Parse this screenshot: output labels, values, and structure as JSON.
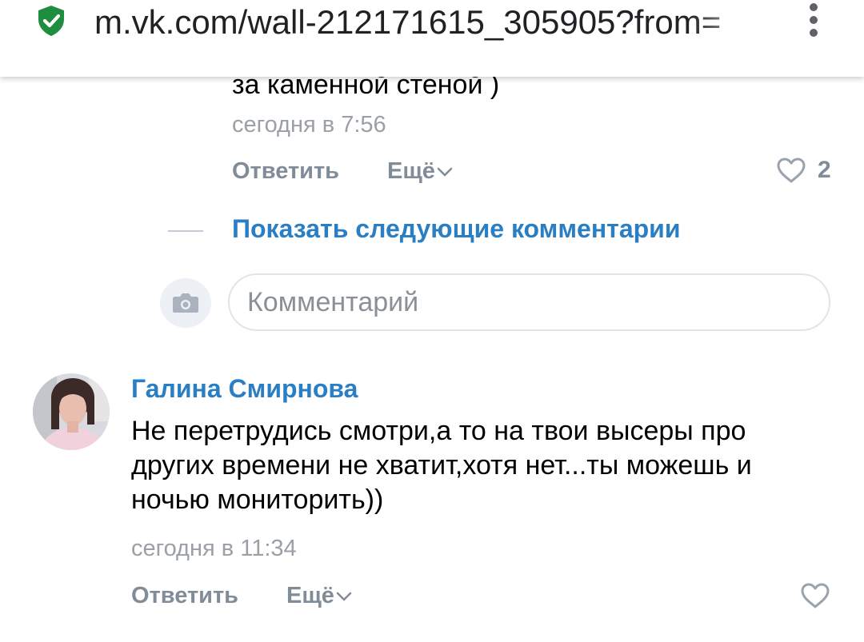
{
  "browser": {
    "url": "m.vk.com/wall-212171615_305905?from="
  },
  "comment_prev": {
    "text_tail": "за каменной стеной )",
    "time": "сегодня в 7:56",
    "reply_label": "Ответить",
    "more_label": "Ещё",
    "likes": "2"
  },
  "thread": {
    "show_more_label": "Показать следующие комментарии"
  },
  "composer": {
    "placeholder": "Комментарий"
  },
  "comment": {
    "author": "Галина Смирнова",
    "lines": [
      "Не перетрудись смотри,а то на твои высеры про",
      "других времени не хватит,хотя нет...ты можешь и",
      "ночью мониторить))"
    ],
    "time": "сегодня в 11:34",
    "reply_label": "Ответить",
    "more_label": "Ещё"
  },
  "colors": {
    "link": "#2a7ec4",
    "secondary": "#818c99",
    "secure": "#1e8e3e"
  }
}
